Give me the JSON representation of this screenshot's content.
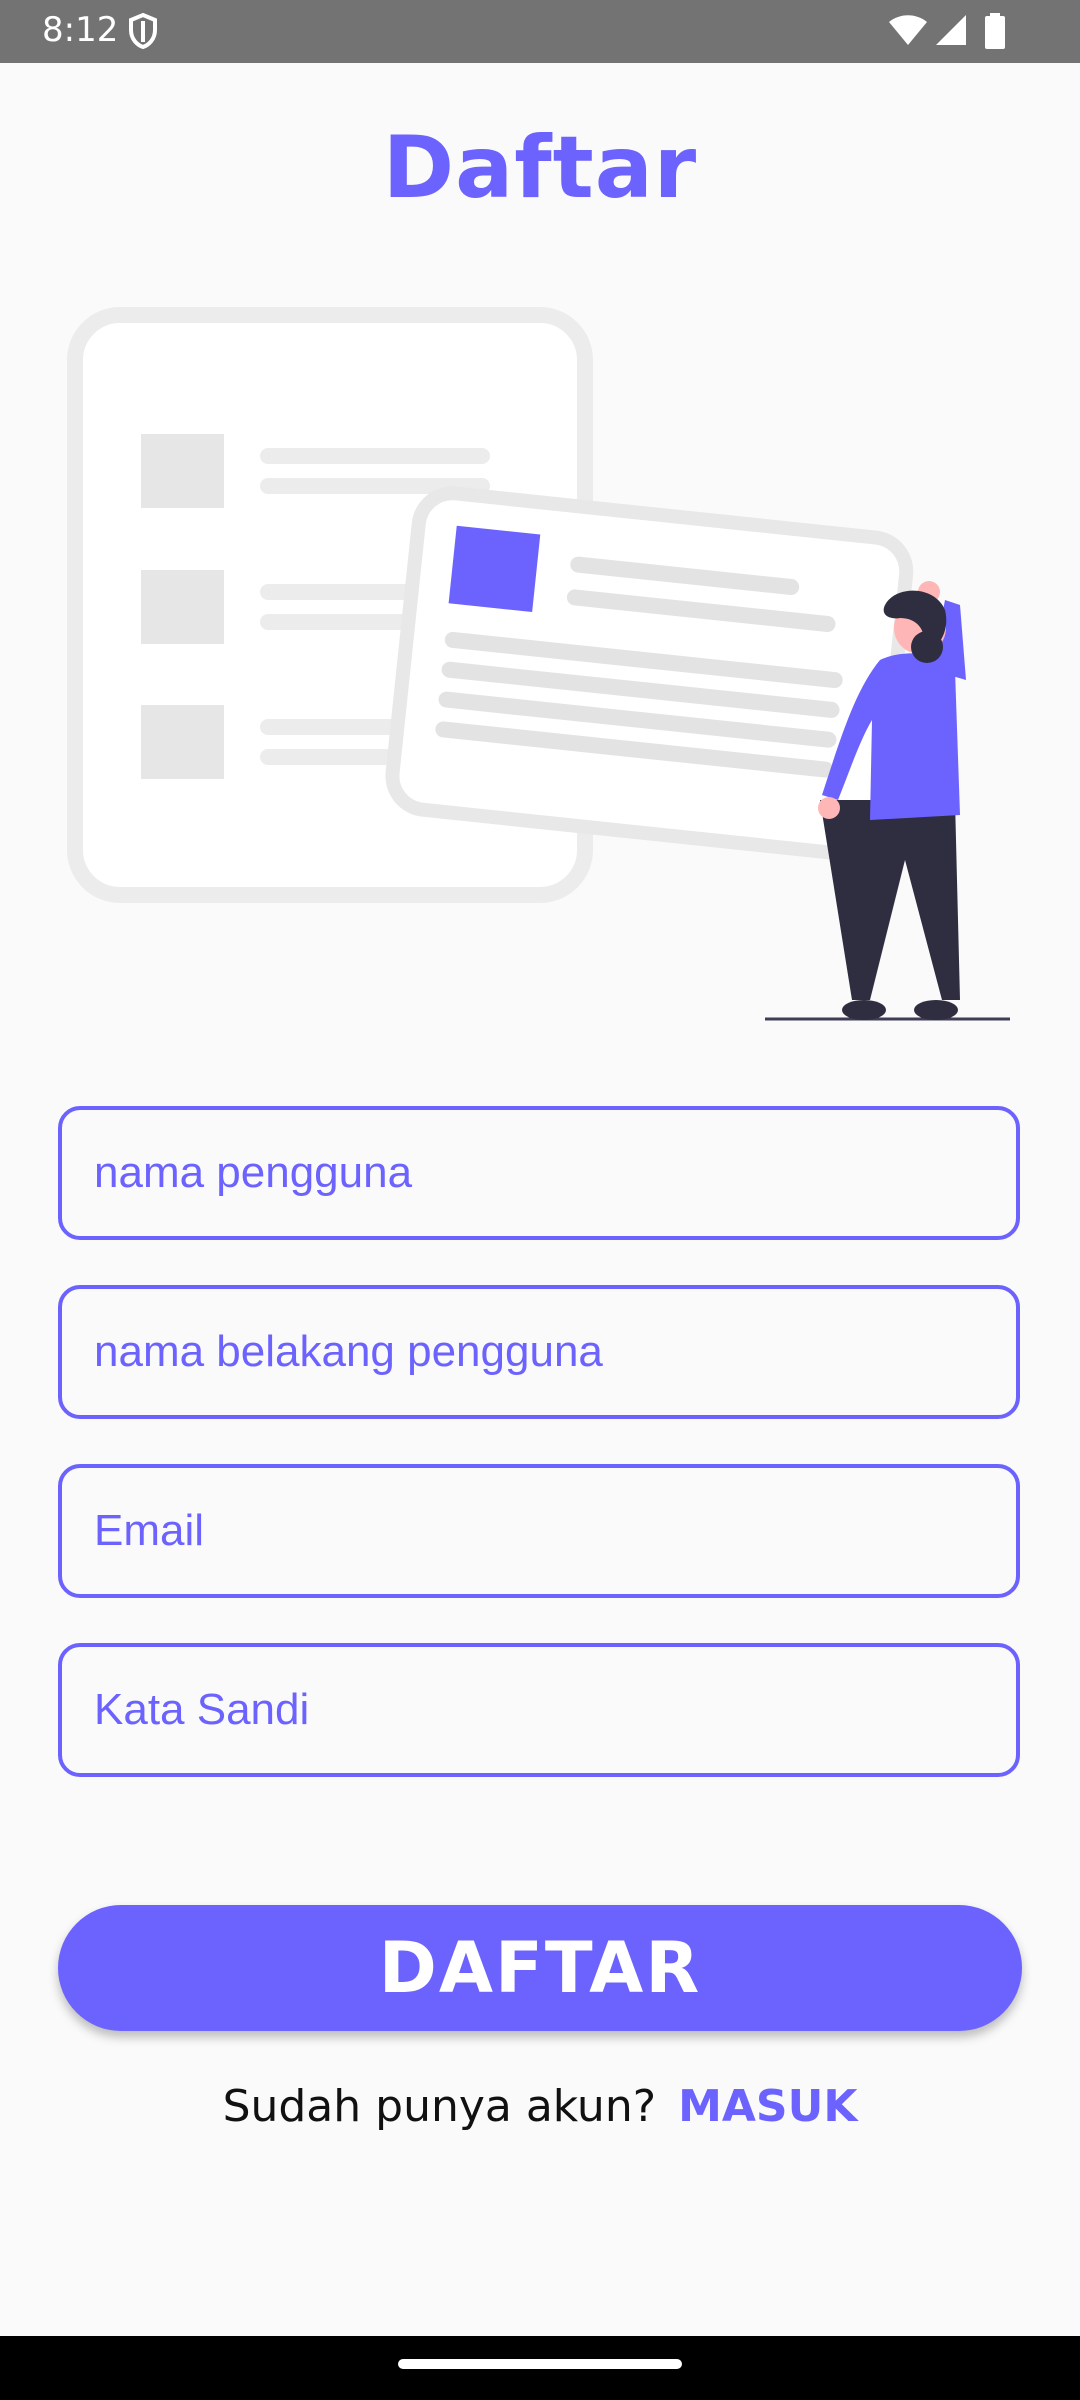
{
  "status_bar": {
    "time": "8:12",
    "icons": [
      "shield-icon",
      "wifi-icon",
      "signal-icon",
      "battery-icon"
    ]
  },
  "page": {
    "title": "Daftar"
  },
  "illustration": {
    "description_icon": "signup-illustration",
    "accent_color": "#6c63ff"
  },
  "form": {
    "first_name": {
      "placeholder": "nama pengguna",
      "value": ""
    },
    "last_name": {
      "placeholder": "nama belakang pengguna",
      "value": ""
    },
    "email": {
      "placeholder": "Email",
      "value": ""
    },
    "password": {
      "placeholder": "Kata Sandi",
      "value": ""
    }
  },
  "actions": {
    "register_label": "DAFTAR",
    "login_prompt": "Sudah punya akun?",
    "login_link": "MASUK"
  },
  "colors": {
    "accent": "#6c63ff",
    "background": "#fafafa",
    "status_bar": "#737373"
  }
}
